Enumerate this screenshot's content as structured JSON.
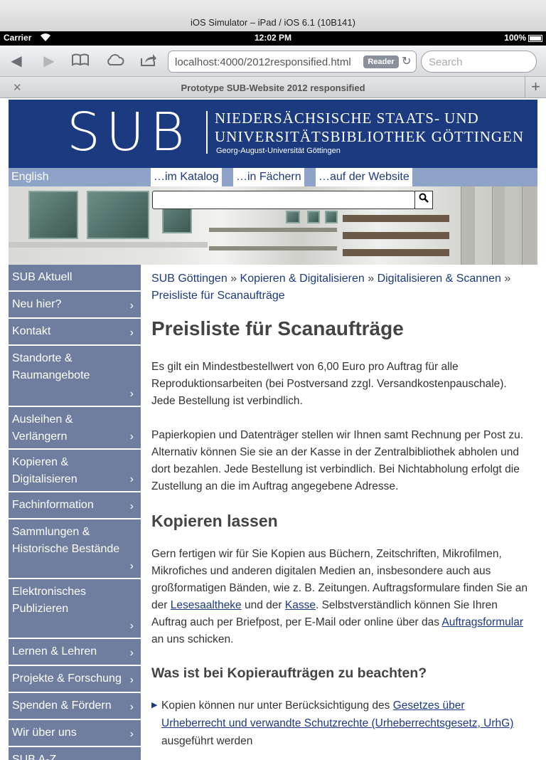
{
  "simulator": {
    "title": "iOS Simulator – iPad / iOS 6.1 (10B141)"
  },
  "status_bar": {
    "carrier": "Carrier",
    "time": "12:02 PM",
    "battery": "100%"
  },
  "toolbar": {
    "url": "localhost:4000/2012responsified.html",
    "reader_label": "Reader",
    "search_placeholder": "Search"
  },
  "tab": {
    "title": "Prototype SUB-Website 2012 responsified"
  },
  "banner": {
    "logo": "SUB",
    "line1": "NIEDERSÄCHSISCHE STAATS- UND",
    "line2": "UNIVERSITÄTSBIBLIOTHEK GÖTTINGEN",
    "line3": "Georg-August-Universität Göttingen"
  },
  "menu": {
    "language": "English",
    "search_tabs": [
      "…im Katalog",
      "…in Fächern",
      "…auf der Website"
    ]
  },
  "sidebar": {
    "items": [
      {
        "label": "SUB Aktuell",
        "chevron": ""
      },
      {
        "label": "Neu hier?",
        "chevron": "›"
      },
      {
        "label": "Kontakt",
        "chevron": "›"
      },
      {
        "label": "Standorte & Raumangebote",
        "chevron": "›"
      },
      {
        "label": "Ausleihen & Verlängern",
        "chevron": "›"
      },
      {
        "label": "Kopieren & Digitalisieren",
        "chevron": "›"
      },
      {
        "label": "Fachinformation",
        "chevron": "›"
      },
      {
        "label": "Sammlungen & Historische Bestände",
        "chevron": "›"
      },
      {
        "label": "Elektronisches Publizieren",
        "chevron": "›"
      },
      {
        "label": "Lernen & Lehren",
        "chevron": "›"
      },
      {
        "label": "Projekte & Forschung",
        "chevron": "›"
      },
      {
        "label": "Spenden & Fördern",
        "chevron": "›"
      },
      {
        "label": "Wir über uns",
        "chevron": "›"
      },
      {
        "label": "SUB A-Z",
        "chevron": ""
      }
    ]
  },
  "breadcrumb": {
    "items": [
      "SUB Göttingen",
      "Kopieren & Digitalisieren",
      "Digitalisieren & Scannen",
      "Preisliste für Scanaufträge"
    ],
    "separator": "»"
  },
  "content": {
    "title": "Preisliste für Scanaufträge",
    "p1": "Es gilt ein Mindestbestellwert von 6,00 Euro pro Auftrag für alle Reproduktionsarbeiten (bei Postversand zzgl. Versandkostenpauschale). Jede Bestellung ist verbindlich.",
    "p2": "Papierkopien und Datenträger stellen wir Ihnen samt Rechnung per Post zu. Alternativ können Sie sie an der Kasse in der Zentralbibliothek abholen und dort bezahlen. Jede Bestellung ist verbindlich. Bei Nichtabholung erfolgt die Zustellung an die im Auftrag angegebene Adresse.",
    "h2": "Kopieren lassen",
    "p3_a": "Gern fertigen wir für Sie Kopien aus Büchern, Zeitschriften, Mikrofilmen, Mikrofiches und anderen digitalen Medien an, insbesondere auch aus großformatigen Bänden, wie z. B. Zeitungen. Auftragsformulare finden Sie an der ",
    "p3_link1": "Lesesaaltheke",
    "p3_b": " und der ",
    "p3_link2": "Kasse",
    "p3_c": ". Selbstverständlich können Sie Ihren Auftrag auch per Briefpost, per E-Mail oder online über das ",
    "p3_link3": "Auftragsformular",
    "p3_d": " an uns schicken.",
    "h3": "Was ist bei Kopieraufträgen zu beachten?",
    "li1_a": "Kopien können nur unter Berücksichtigung des ",
    "li1_link": "Gesetzes über Urheberrecht und verwandte Schutzrechte (Urheberrechtsgesetz, UrhG)",
    "li1_b": " ausgeführt werden"
  }
}
